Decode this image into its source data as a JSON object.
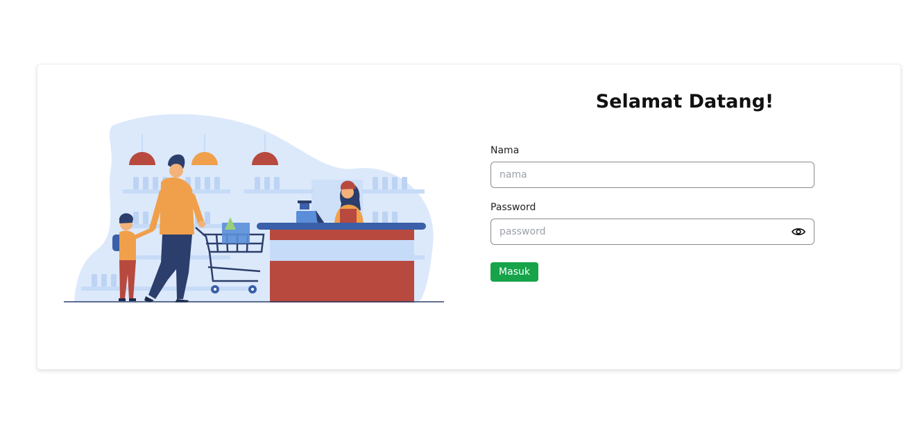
{
  "login": {
    "title": "Selamat Datang!",
    "name_label": "Nama",
    "name_placeholder": "nama",
    "name_value": "",
    "password_label": "Password",
    "password_placeholder": "password",
    "password_value": "",
    "submit_label": "Masuk"
  },
  "icons": {
    "password_toggle": "eye-icon"
  },
  "colors": {
    "submit_button": "#16a34a",
    "illustration_blob": "#dce9fb",
    "counter_red": "#b8493f",
    "counter_blue": "#3b5fa8",
    "lamp_orange": "#f0a04b"
  }
}
